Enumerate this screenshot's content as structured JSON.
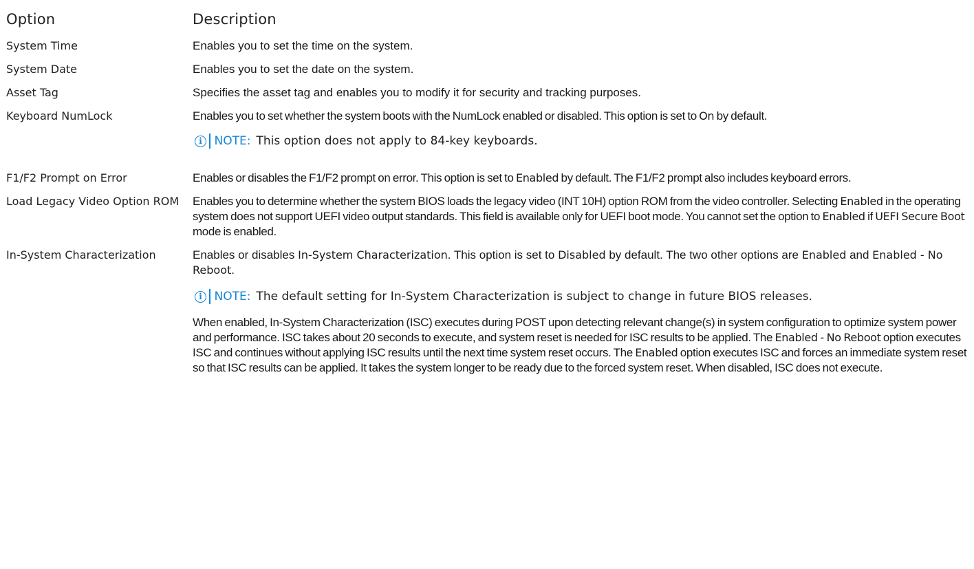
{
  "header": {
    "option": "Option",
    "description": "Description"
  },
  "rows": [
    {
      "option": "System Time",
      "desc": "Enables you to set the time on the system."
    },
    {
      "option": "System Date",
      "desc": "Enables you to set the date on the system."
    },
    {
      "option": "Asset Tag",
      "desc": "Specifies the asset tag and enables you to modify it for security and tracking purposes."
    },
    {
      "option": "Keyboard NumLock",
      "desc_a": "Enables you to set whether the system boots with the NumLock enabled or disabled. This option is set to ",
      "desc_val": "On",
      "desc_b": " by default.",
      "note_label": "NOTE:",
      "note_text": "This option does not apply to 84-key keyboards."
    },
    {
      "option": "F1/F2 Prompt on Error",
      "desc_a": "Enables or disables the F1/F2 prompt on error. This option is set to ",
      "desc_val": "Enabled",
      "desc_b": " by default. The F1/F2 prompt also includes keyboard errors."
    },
    {
      "option": "Load Legacy Video Option ROM",
      "desc_a": "Enables you to determine whether the system BIOS loads the legacy video (INT 10H) option ROM from the video controller. Selecting ",
      "desc_val": "Enabled",
      "desc_b": " in the operating system does not support UEFI video output standards. This field is available only for UEFI boot mode. You cannot set the option to ",
      "desc_val2": "Enabled",
      "desc_c": " if ",
      "desc_val3": "UEFI Secure Boot",
      "desc_d": " mode is enabled."
    },
    {
      "option": "In-System Characterization",
      "desc_a": "Enables or disables ",
      "desc_val": "In-System Characterization",
      "desc_b": ". This option is set to ",
      "desc_val2": "Disabled",
      "desc_c": " by default. The two other options are ",
      "desc_val3": "Enabled",
      "desc_d": " and ",
      "desc_val4": "Enabled - No Reboot",
      "desc_e": ".",
      "note_label": "NOTE:",
      "note_text": "The default setting for In-System Characterization is subject to change in future BIOS releases.",
      "para_a": "When enabled, In-System Characterization (ISC) executes during POST upon detecting relevant change(s) in system configuration to optimize system power and performance. ISC takes about 20 seconds to execute, and system reset is needed for ISC results to be applied. The ",
      "para_val": "Enabled - No Reboot",
      "para_b": " option executes ISC and continues without applying ISC results until the next time system reset occurs. The ",
      "para_val2": "Enabled",
      "para_c": " option executes ISC and forces an immediate system reset so that ISC results can be applied. It takes the system longer to be ready due to the forced system reset. When disabled, ISC does not execute."
    }
  ],
  "icons": {
    "note": "info-icon"
  },
  "colors": {
    "accent": "#1486d4"
  }
}
